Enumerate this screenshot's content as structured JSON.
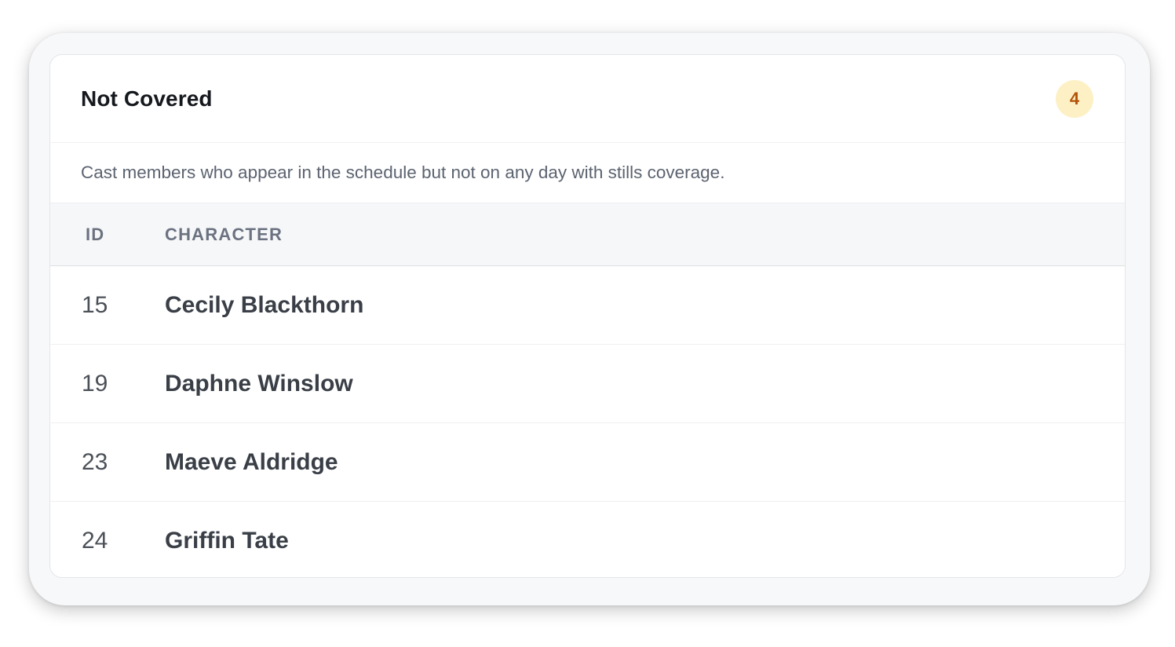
{
  "panel": {
    "title": "Not Covered",
    "count_badge": "4",
    "description": "Cast members who appear in the schedule but not on any day with stills coverage.",
    "badge_color": "#fdf0c4",
    "badge_text_color": "#b45309"
  },
  "table": {
    "columns": [
      "ID",
      "CHARACTER"
    ],
    "rows": [
      {
        "id": "15",
        "character": "Cecily Blackthorn"
      },
      {
        "id": "19",
        "character": "Daphne Winslow"
      },
      {
        "id": "23",
        "character": "Maeve Aldridge"
      },
      {
        "id": "24",
        "character": "Griffin Tate"
      }
    ]
  }
}
